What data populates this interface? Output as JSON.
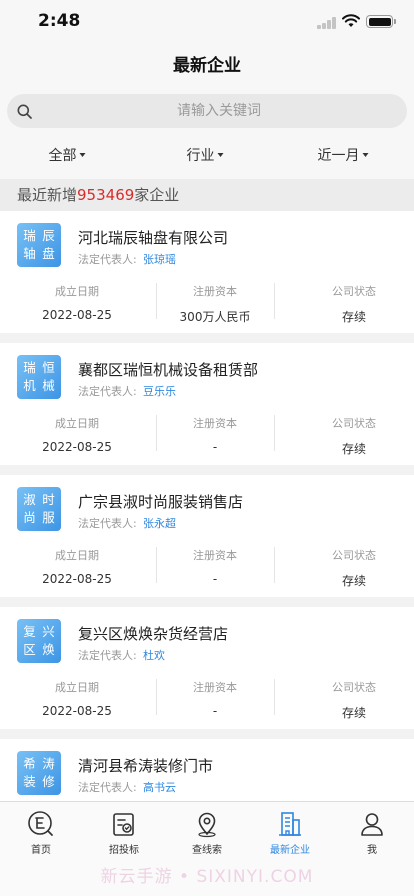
{
  "status_bar": {
    "time": "2:48"
  },
  "nav": {
    "title": "最新企业"
  },
  "search": {
    "placeholder": "请输入关键词",
    "value": ""
  },
  "filters": [
    {
      "label": "全部"
    },
    {
      "label": "行业"
    },
    {
      "label": "近一月"
    }
  ],
  "summary": {
    "prefix": "最近新增",
    "count": "953469",
    "suffix": "家企业"
  },
  "companies": [
    {
      "logo": [
        "瑞",
        "辰",
        "轴",
        "盘"
      ],
      "name": "河北瑞辰轴盘有限公司",
      "legal_label": "法定代表人:",
      "legal_name": "张琼瑶",
      "stats": [
        {
          "label": "成立日期",
          "value": "2022-08-25"
        },
        {
          "label": "注册资本",
          "value": "300万人民币"
        },
        {
          "label": "公司状态",
          "value": "存续"
        }
      ]
    },
    {
      "logo": [
        "瑞",
        "恒",
        "机",
        "械"
      ],
      "name": "襄都区瑞恒机械设备租赁部",
      "legal_label": "法定代表人:",
      "legal_name": "豆乐乐",
      "stats": [
        {
          "label": "成立日期",
          "value": "2022-08-25"
        },
        {
          "label": "注册资本",
          "value": "-"
        },
        {
          "label": "公司状态",
          "value": "存续"
        }
      ]
    },
    {
      "logo": [
        "淑",
        "时",
        "尚",
        "服"
      ],
      "name": "广宗县淑时尚服装销售店",
      "legal_label": "法定代表人:",
      "legal_name": "张永超",
      "stats": [
        {
          "label": "成立日期",
          "value": "2022-08-25"
        },
        {
          "label": "注册资本",
          "value": "-"
        },
        {
          "label": "公司状态",
          "value": "存续"
        }
      ]
    },
    {
      "logo": [
        "复",
        "兴",
        "区",
        "焕"
      ],
      "name": "复兴区焕焕杂货经营店",
      "legal_label": "法定代表人:",
      "legal_name": "杜欢",
      "stats": [
        {
          "label": "成立日期",
          "value": "2022-08-25"
        },
        {
          "label": "注册资本",
          "value": "-"
        },
        {
          "label": "公司状态",
          "value": "存续"
        }
      ]
    },
    {
      "logo": [
        "希",
        "涛",
        "装",
        "修"
      ],
      "name": "清河县希涛装修门市",
      "legal_label": "法定代表人:",
      "legal_name": "高书云",
      "stats": []
    }
  ],
  "tabs": [
    {
      "label": "首页",
      "icon": "home-icon"
    },
    {
      "label": "招投标",
      "icon": "bidding-icon"
    },
    {
      "label": "查线索",
      "icon": "location-pin-icon"
    },
    {
      "label": "最新企业",
      "icon": "buildings-icon"
    },
    {
      "label": "我",
      "icon": "user-icon"
    }
  ],
  "active_tab": "最新企业",
  "watermark": "新云手游 • SIXINYI.COM",
  "colors": {
    "accent": "#2f87e0",
    "count_red": "#d82c2c",
    "logo_blue": "#4a9de6"
  }
}
